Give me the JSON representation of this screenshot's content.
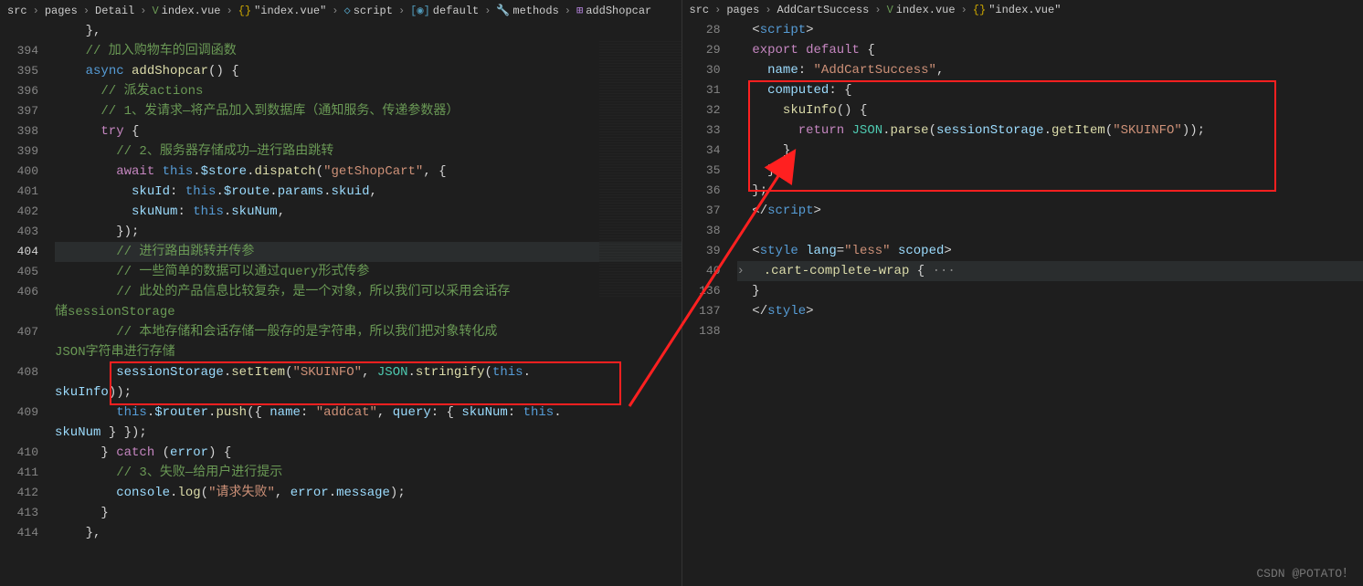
{
  "left": {
    "breadcrumb": [
      {
        "label": "src",
        "icon": ""
      },
      {
        "label": "pages",
        "icon": ""
      },
      {
        "label": "Detail",
        "icon": ""
      },
      {
        "label": "index.vue",
        "icon": "V",
        "iconClass": "ic-green"
      },
      {
        "label": "\"index.vue\"",
        "icon": "{}",
        "iconClass": "ic-yellow"
      },
      {
        "label": "script",
        "icon": "◇",
        "iconClass": "ic-blue"
      },
      {
        "label": "default",
        "icon": "[◉]",
        "iconClass": "ic-blue"
      },
      {
        "label": "methods",
        "icon": "🔧",
        "iconClass": "ic-blue"
      },
      {
        "label": "addShopcar",
        "icon": "⊞",
        "iconClass": "ic-purple"
      }
    ],
    "gutterStart": 394,
    "gutter": [
      "",
      "394",
      "395",
      "396",
      "397",
      "398",
      "399",
      "400",
      "401",
      "402",
      "403",
      "404",
      "405",
      "406",
      "",
      "407",
      "",
      "408",
      "",
      "409",
      "",
      "410",
      "411",
      "412",
      "413",
      "414"
    ],
    "activeLine": "404",
    "code": {
      "l0": "    },",
      "c1": "    // 加入购物车的回调函数",
      "l2_a": "    ",
      "l2_async": "async ",
      "l2_fn": "addShopcar",
      "l2_b": "() {",
      "c3": "      // 派发actions",
      "c4": "      // 1、发请求—将产品加入到数据库（通知服务、传递参数器）",
      "l5_try": "      try ",
      "l5_b": "{",
      "c6": "        // 2、服务器存储成功—进行路由跳转",
      "l7_a": "        ",
      "l7_await": "await ",
      "l7_this": "this",
      "l7_b": ".",
      "l7_store": "$store",
      "l7_c": ".",
      "l7_disp": "dispatch",
      "l7_d": "(",
      "l7_s": "\"getShopCart\"",
      "l7_e": ", {",
      "l8_a": "          ",
      "l8_skuId": "skuId",
      "l8_b": ": ",
      "l8_this": "this",
      "l8_c": ".",
      "l8_route": "$route",
      "l8_d": ".",
      "l8_params": "params",
      "l8_e": ".",
      "l8_skuid": "skuid",
      "l8_f": ",",
      "l9_a": "          ",
      "l9_skuNum": "skuNum",
      "l9_b": ": ",
      "l9_this": "this",
      "l9_c": ".",
      "l9_sn": "skuNum",
      "l9_d": ",",
      "l10": "        });",
      "c11": "        // 进行路由跳转并传参",
      "c12": "        // 一些简单的数据可以通过query形式传参",
      "c13": "        // 此处的产品信息比较复杂，是一个对象，所以我们可以采用会话存储sessionStorage",
      "c13b": "储sessionStorage",
      "c14": "        // 本地存储和会话存储一般存的是字符串，所以我们把对象转化成JSON字符串进行存储",
      "c14b": "JSON字符串进行存储",
      "l15_a": "        ",
      "l15_ss": "sessionStorage",
      "l15_b": ".",
      "l15_set": "setItem",
      "l15_c": "(",
      "l15_s": "\"SKUINFO\"",
      "l15_d": ", ",
      "l15_json": "JSON",
      "l15_e": ".",
      "l15_str": "stringify",
      "l15_f": "(",
      "l15_this": "this",
      "l15_g": ".",
      "l15b_a": "",
      "l15b_sku": "skuInfo",
      "l15b_b": "));",
      "l16_a": "        ",
      "l16_this": "this",
      "l16_b": ".",
      "l16_r": "$router",
      "l16_c": ".",
      "l16_push": "push",
      "l16_d": "({ ",
      "l16_name": "name",
      "l16_e": ": ",
      "l16_s": "\"addcat\"",
      "l16_f": ", ",
      "l16_q": "query",
      "l16_g": ": { ",
      "l16_sn": "skuNum",
      "l16_h": ": ",
      "l16_this2": "this",
      "l16_i": ".",
      "l16b_a": "",
      "l16b_sku": "skuNum",
      "l16b_b": " } });",
      "l17_a": "      } ",
      "l17_catch": "catch ",
      "l17_b": "(",
      "l17_err": "error",
      "l17_c": ") {",
      "c18": "        // 3、失败—给用户进行提示",
      "l19_a": "        ",
      "l19_con": "console",
      "l19_b": ".",
      "l19_log": "log",
      "l19_c": "(",
      "l19_s": "\"请求失败\"",
      "l19_d": ", ",
      "l19_err": "error",
      "l19_e": ".",
      "l19_msg": "message",
      "l19_f": ");",
      "l20": "      }",
      "l21": "    },"
    }
  },
  "right": {
    "breadcrumb": [
      {
        "label": "src",
        "icon": ""
      },
      {
        "label": "pages",
        "icon": ""
      },
      {
        "label": "AddCartSuccess",
        "icon": ""
      },
      {
        "label": "index.vue",
        "icon": "V",
        "iconClass": "ic-green"
      },
      {
        "label": "\"index.vue\"",
        "icon": "{}",
        "iconClass": "ic-yellow"
      }
    ],
    "gutter": [
      "28",
      "29",
      "30",
      "31",
      "32",
      "33",
      "34",
      "35",
      "36",
      "37",
      "38",
      "39",
      "40",
      "136",
      "137",
      "138"
    ],
    "code": {
      "l28": "  <",
      "l28_t": "script",
      "l28_b": ">",
      "l29_a": "  ",
      "l29_exp": "export ",
      "l29_def": "default ",
      "l29_b": "{",
      "l30_a": "    ",
      "l30_name": "name",
      "l30_b": ": ",
      "l30_s": "\"AddCartSuccess\"",
      "l30_c": ",",
      "l31_a": "    ",
      "l31_comp": "computed",
      "l31_b": ": {",
      "l32_a": "      ",
      "l32_fn": "skuInfo",
      "l32_b": "() {",
      "l33_a": "        ",
      "l33_ret": "return ",
      "l33_json": "JSON",
      "l33_b": ".",
      "l33_parse": "parse",
      "l33_c": "(",
      "l33_ss": "sessionStorage",
      "l33_d": ".",
      "l33_get": "getItem",
      "l33_e": "(",
      "l33_s": "\"SKUINFO\"",
      "l33_f": "));",
      "l34": "      },",
      "l35": "    },",
      "l36": "  };",
      "l37_a": "  </",
      "l37_t": "script",
      "l37_b": ">",
      "l38": "",
      "l39_a": "  <",
      "l39_t": "style ",
      "l39_lang": "lang",
      "l39_b": "=",
      "l39_s": "\"less\"",
      "l39_sc": " scoped",
      "l39_c": ">",
      "l40_a": "  .",
      "l40_cls": "cart-complete-wrap ",
      "l40_b": "{",
      "l40_dots": " ···",
      "l136": "  }",
      "l137_a": "  </",
      "l137_t": "style",
      "l137_b": ">",
      "l138": ""
    }
  },
  "watermark": "CSDN @POTATO！"
}
